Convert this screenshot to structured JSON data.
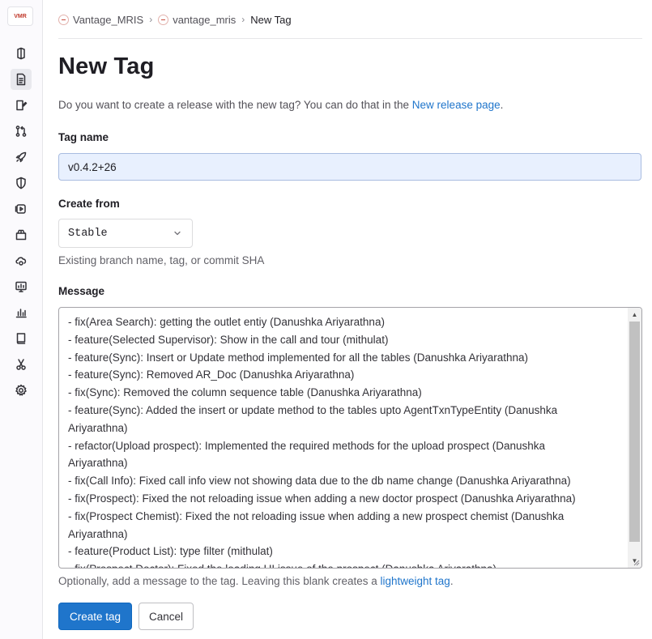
{
  "sidebar": {
    "logo_text": "VMR",
    "items": [
      {
        "icon": "project-icon"
      },
      {
        "icon": "repository-icon",
        "active": true
      },
      {
        "icon": "issues-icon"
      },
      {
        "icon": "merge-requests-icon"
      },
      {
        "icon": "deploy-rocket-icon"
      },
      {
        "icon": "security-shield-icon"
      },
      {
        "icon": "deployments-icon"
      },
      {
        "icon": "packages-icon"
      },
      {
        "icon": "infrastructure-icon"
      },
      {
        "icon": "monitor-icon"
      },
      {
        "icon": "analytics-icon"
      },
      {
        "icon": "wiki-icon"
      },
      {
        "icon": "snippets-icon"
      },
      {
        "icon": "settings-icon"
      }
    ]
  },
  "breadcrumb": {
    "group": "Vantage_MRIS",
    "project": "vantage_mris",
    "current": "New Tag"
  },
  "page": {
    "title": "New Tag",
    "intro_text": "Do you want to create a release with the new tag? You can do that in the ",
    "intro_link": "New release page",
    "intro_end": "."
  },
  "form": {
    "tag_name_label": "Tag name",
    "tag_name_value": "v0.4.2+26",
    "create_from_label": "Create from",
    "create_from_value": "Stable",
    "create_from_help": "Existing branch name, tag, or commit SHA",
    "message_label": "Message",
    "message_lines": [
      "- fix(Area Search): getting the outlet entiy (Danushka Ariyarathna)",
      "- feature(Selected Supervisor): Show in the call and tour (mithulat)",
      "- feature(Sync): Insert or Update method implemented  for all the tables (Danushka Ariyarathna)",
      "- feature(Sync): Removed AR_Doc (Danushka Ariyarathna)",
      "- fix(Sync): Removed the column sequence table (Danushka Ariyarathna)",
      "- feature(Sync): Added the insert or update method to the tables upto AgentTxnTypeEntity (Danushka",
      "Ariyarathna)",
      "- refactor(Upload prospect): Implemented the required methods for the upload prospect (Danushka",
      "Ariyarathna)",
      "- fix(Call Info): Fixed call info view not showing data due to the db name change (Danushka Ariyarathna)",
      "- fix(Prospect): Fixed the not reloading issue when adding a new doctor prospect (Danushka Ariyarathna)",
      "- fix(Prospect Chemist): Fixed the not reloading issue when adding a new prospect chemist (Danushka",
      "Ariyarathna)",
      "- feature(Product List): type filter (mithulat)",
      "- fix(Prospect Doctor): Fixed the loading UI issue of the prospect (Danushka Ariyarathna)"
    ],
    "message_help_text": "Optionally, add a message to the tag. Leaving this blank creates a ",
    "message_help_link": "lightweight tag",
    "message_help_end": "."
  },
  "actions": {
    "create_label": "Create tag",
    "cancel_label": "Cancel"
  },
  "colors": {
    "accent": "#1f75cb",
    "input_autofill_bg": "#e8f0fe"
  }
}
